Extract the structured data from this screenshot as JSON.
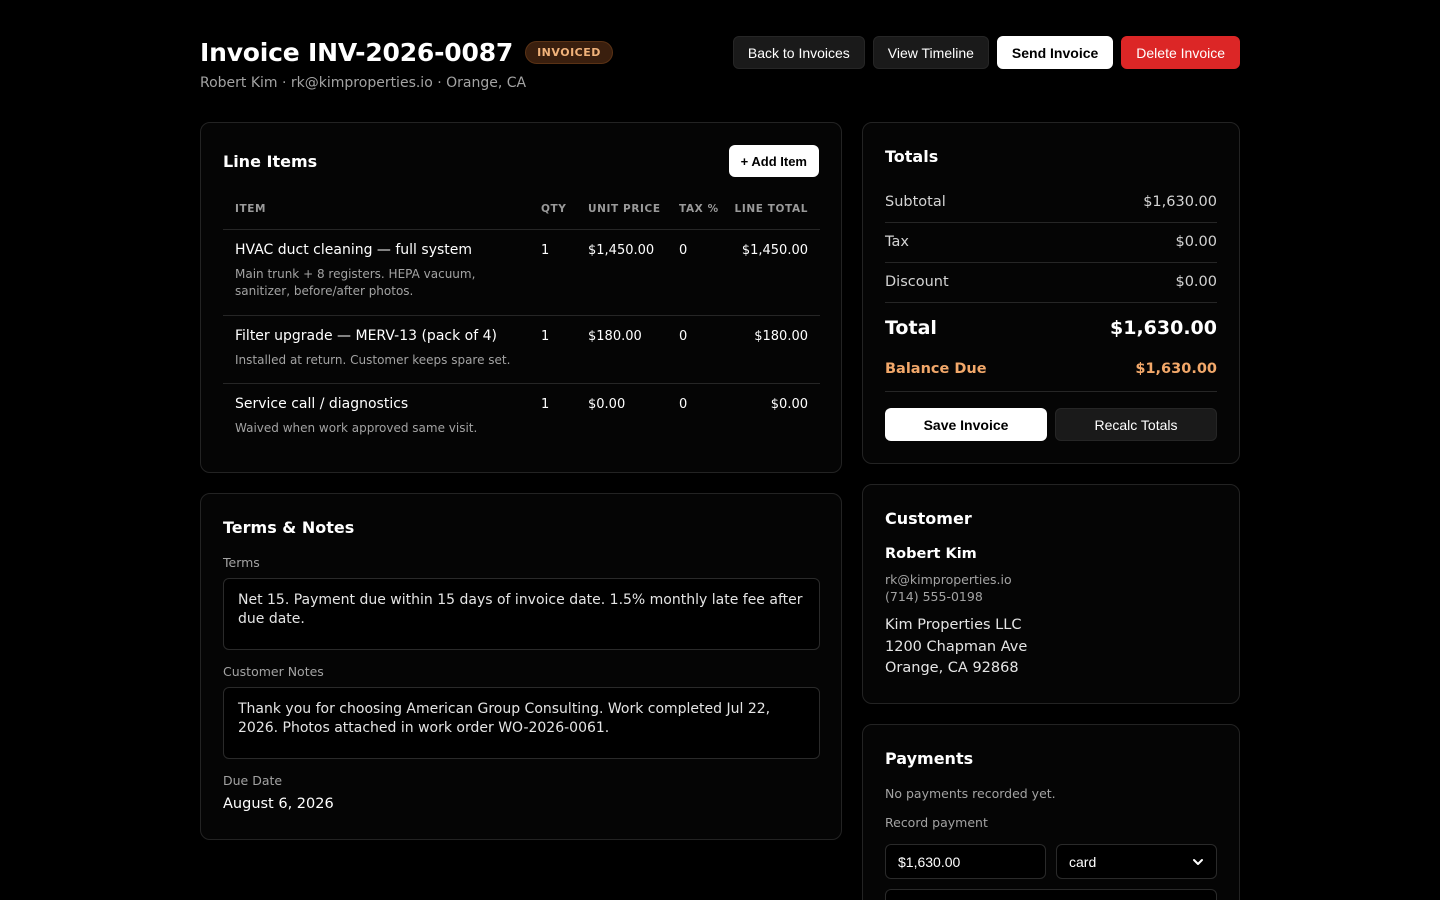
{
  "header": {
    "title": "Invoice INV-2026-0087",
    "status": "INVOICED",
    "subtitle": "Robert Kim · rk@kimproperties.io · Orange, CA",
    "actions": {
      "back": "Back to Invoices",
      "timeline": "View Timeline",
      "send": "Send Invoice",
      "delete": "Delete Invoice"
    }
  },
  "line_items": {
    "title": "Line Items",
    "add_label": "+ Add Item",
    "columns": [
      "ITEM",
      "QTY",
      "UNIT PRICE",
      "TAX %",
      "LINE TOTAL"
    ],
    "rows": [
      {
        "name": "HVAC duct cleaning — full system",
        "description": "Main trunk + 8 registers. HEPA vacuum, sanitizer, before/after photos.",
        "qty": "1",
        "unit_price": "$1,450.00",
        "tax": "0",
        "total": "$1,450.00"
      },
      {
        "name": "Filter upgrade — MERV-13 (pack of 4)",
        "description": "Installed at return. Customer keeps spare set.",
        "qty": "1",
        "unit_price": "$180.00",
        "tax": "0",
        "total": "$180.00"
      },
      {
        "name": "Service call / diagnostics",
        "description": "Waived when work approved same visit.",
        "qty": "1",
        "unit_price": "$0.00",
        "tax": "0",
        "total": "$0.00"
      }
    ]
  },
  "terms": {
    "title": "Terms & Notes",
    "terms_label": "Terms",
    "terms_value": "Net 15. Payment due within 15 days of invoice date. 1.5% monthly late fee after due date.",
    "notes_label": "Customer Notes",
    "notes_value": "Thank you for choosing American Group Consulting. Work completed Jul 22, 2026. Photos attached in work order WO-2026-0061.",
    "due_label": "Due Date",
    "due_value": "August 6, 2026"
  },
  "totals": {
    "title": "Totals",
    "subtotal_label": "Subtotal",
    "subtotal": "$1,630.00",
    "tax_label": "Tax",
    "tax": "$0.00",
    "discount_label": "Discount",
    "discount": "$0.00",
    "total_label": "Total",
    "total": "$1,630.00",
    "balance_label": "Balance Due",
    "balance": "$1,630.00",
    "save_label": "Save Invoice",
    "recalc_label": "Recalc Totals"
  },
  "customer": {
    "title": "Customer",
    "name": "Robert Kim",
    "email": "rk@kimproperties.io",
    "phone": "(714) 555-0198",
    "company": "Kim Properties LLC",
    "street": "1200 Chapman Ave",
    "city": "Orange, CA 92868"
  },
  "payments": {
    "title": "Payments",
    "empty": "No payments recorded yet.",
    "record_label": "Record payment",
    "amount_value": "$1,630.00",
    "method_value": "card"
  },
  "colors": {
    "background": "#000000",
    "danger": "#dc2626",
    "balance_accent": "#f2a86a",
    "badge_text": "#f0b27a"
  }
}
